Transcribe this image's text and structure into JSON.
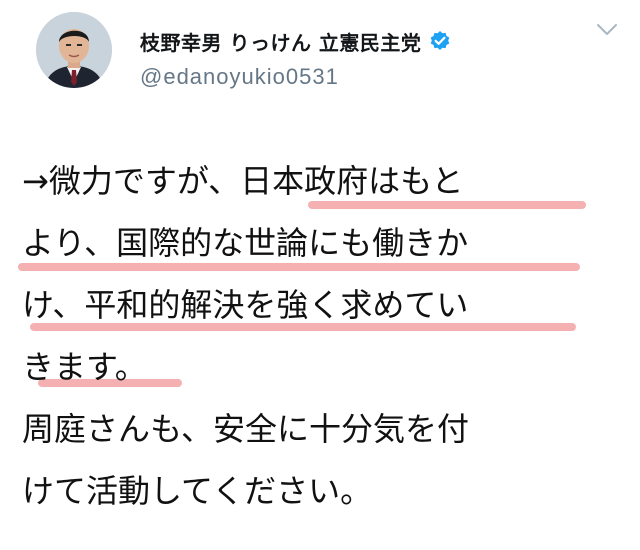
{
  "account": {
    "display_name": "枝野幸男 りっけん 立憲民主党",
    "handle": "@edanoyukio0531",
    "verified": true
  },
  "icons": {
    "avatar": "profile-photo",
    "verified": "verified-badge-icon",
    "menu": "chevron-down-icon"
  },
  "colors": {
    "verified_blue": "#1da1f2",
    "handle_gray": "#657786",
    "highlight_pink": "#f4a9a9"
  },
  "tweet": {
    "lines": [
      "→微力ですが、日本政府はもと",
      "より、国際的な世論にも働きか",
      "け、平和的解決を強く求めてい",
      "きます。",
      "周庭さんも、安全に十分気を付",
      "けて活動してください。"
    ]
  }
}
